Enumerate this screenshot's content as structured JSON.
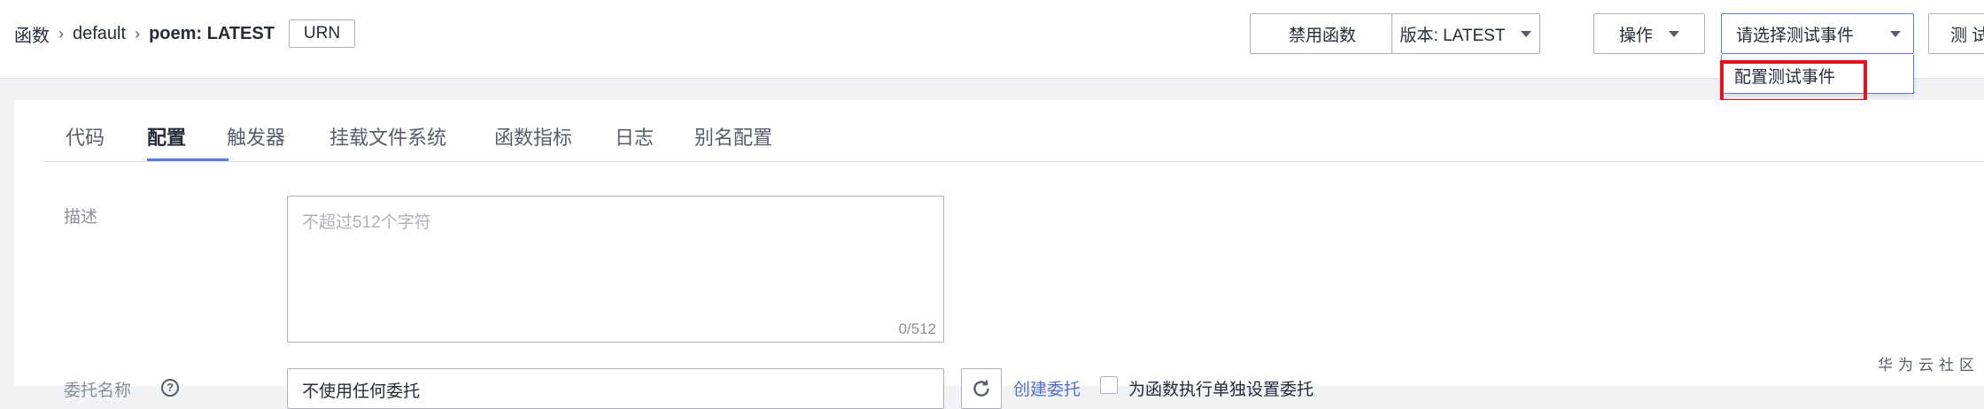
{
  "breadcrumb": {
    "root": "函数",
    "level2": "default",
    "current": "poem: LATEST",
    "urn": "URN"
  },
  "toolbar": {
    "disable": "禁用函数",
    "version": "版本: LATEST",
    "operate": "操作",
    "select_placeholder": "请选择测试事件",
    "test": "测 试"
  },
  "dropdown": {
    "configure_event": "配置测试事件"
  },
  "tabs": [
    {
      "label": "代码"
    },
    {
      "label": "配置"
    },
    {
      "label": "触发器"
    },
    {
      "label": "挂载文件系统"
    },
    {
      "label": "函数指标"
    },
    {
      "label": "日志"
    },
    {
      "label": "别名配置"
    }
  ],
  "form": {
    "description_label": "描述",
    "description_placeholder": "不超过512个字符",
    "description_count": "0/512",
    "agency_label": "委托名称",
    "agency_value": "不使用任何委托",
    "create_agency": "创建委托",
    "separate_setting": "为函数执行单独设置委托"
  },
  "watermark": "华为云社区"
}
